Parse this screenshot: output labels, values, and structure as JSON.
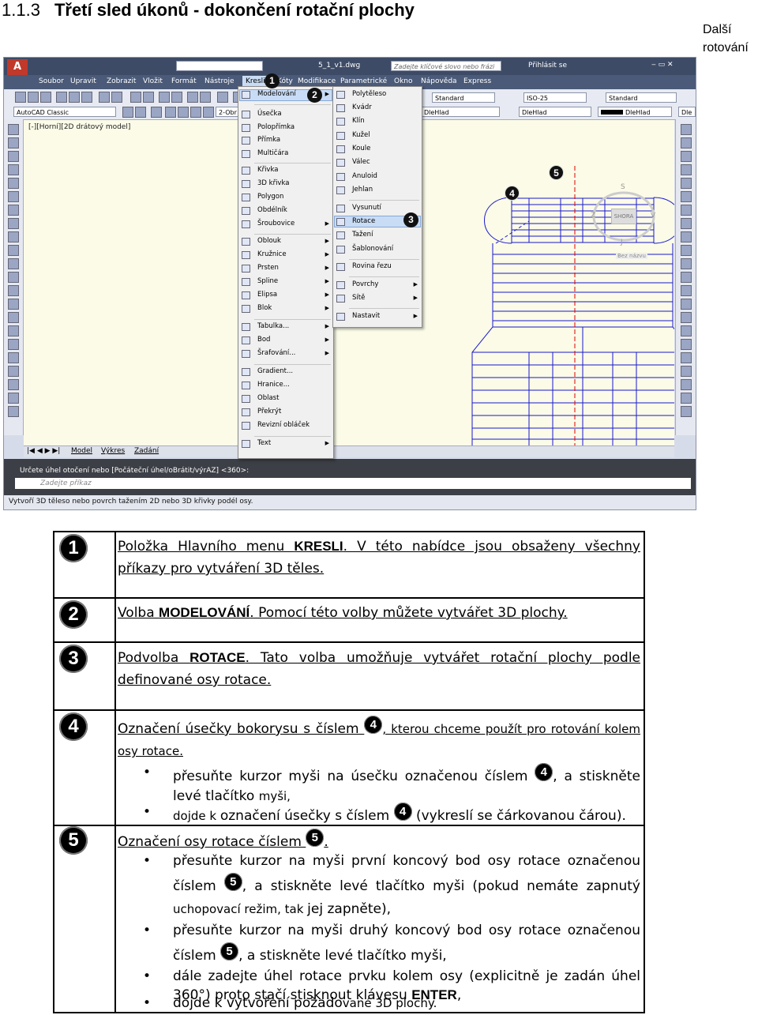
{
  "heading": {
    "number": "1.1.3",
    "title": "Třetí sled úkonů - dokončení rotační plochy"
  },
  "side_note": "Další rotování",
  "screenshot": {
    "workspace": "AutoCAD Classic",
    "filename": "5_1_v1.dwg",
    "search_placeholder": "Zadejte klíčové slovo nebo frázi",
    "signin": "Přihlásit se",
    "menubar": [
      "Soubor",
      "Upravit",
      "Zobrazit",
      "Vložit",
      "Formát",
      "Nástroje",
      "Kresli",
      "Kóty",
      "Modifikace",
      "Parametrické",
      "Okno",
      "Nápověda",
      "Express"
    ],
    "toolbar": {
      "workspace_combo": "AutoCAD Classic",
      "text_style": "Standard",
      "dim_style": "ISO-25",
      "table_style": "Standard",
      "layer": "2-Obr",
      "linetype": "DleHlad",
      "lineweight": "DleHlad",
      "color": "DleHlad",
      "plot": "Dle"
    },
    "viewport_label": "[-][Horní][2D drátový model]",
    "viewcube": {
      "top": "S",
      "right": "V",
      "left": "Z",
      "bottom": "J",
      "face": "SHORA",
      "ucs": "Bez názvu"
    },
    "draw_menu": [
      "Modelování",
      "Úsečka",
      "Polopřímka",
      "Přímka",
      "Multičára",
      "Křivka",
      "3D křivka",
      "Polygon",
      "Obdélník",
      "Šroubovice",
      "Oblouk",
      "Kružnice",
      "Prsten",
      "Spline",
      "Elipsa",
      "Blok",
      "Tabulka...",
      "Bod",
      "Šrafování...",
      "Gradient...",
      "Hranice...",
      "Oblast",
      "Překrýt",
      "Revizní obláček",
      "Text"
    ],
    "modeling_submenu": [
      "Polytěleso",
      "Kvádr",
      "Klín",
      "Kužel",
      "Koule",
      "Válec",
      "Anuloid",
      "Jehlan",
      "Vysunutí",
      "Rotace",
      "Tažení",
      "Šablonování",
      "Rovina řezu",
      "Povrchy",
      "Sítě",
      "Nastavit"
    ],
    "layout_tabs": [
      "Model",
      "Výkres",
      "Zadání"
    ],
    "command_prompt": "Určete úhel otočení nebo [Počáteční úhel/oBrátit/výrAZ] <360>:",
    "command_placeholder": "Zadejte příkaz",
    "status_text": "Vytvoří 3D těleso nebo povrch tažením 2D nebo 3D křivky podél osy.",
    "callouts": [
      "1",
      "2",
      "3",
      "4",
      "5"
    ]
  },
  "legend": {
    "row1": {
      "marker": "1",
      "a": "Položka Hlavního menu ",
      "b": "KRESLI",
      "c": ". V této nabídce jsou obsaženy všechny příkazy pro vytváření 3D těles."
    },
    "row2": {
      "marker": "2",
      "a": "Volba ",
      "b": "MODELOVÁNÍ",
      "c": ". Pomocí této volby můžete vytvářet 3D plochy."
    },
    "row3": {
      "marker": "3",
      "a": "Podvolba ",
      "b": "ROTACE",
      "c": ". Tato volba umožňuje vytvářet rotační plochy podle definované osy rotace."
    },
    "row4": {
      "marker": "4",
      "lead_a": "Označení úsečky bokorysu s číslem ",
      "lead_marker": "4",
      "lead_b": ", kterou chceme použít pro rotování kolem osy rotace.",
      "b1_a": "přesuňte kurzor myši na úsečku označenou číslem ",
      "b1_marker": "4",
      "b1_b": ", a stiskněte levé tlačítko ",
      "b1_c": "myši,",
      "b2_a": "dojde k ",
      "b2_b": "označení úsečky s číslem ",
      "b2_marker": "4",
      "b2_c": " (vykreslí se čárkovanou čárou)."
    },
    "row5": {
      "marker": "5",
      "lead_a": "Označení osy rotace číslem ",
      "lead_marker": "5",
      "lead_b": ".",
      "b1_a": "přesuňte kurzor na myši první koncový bod osy rotace označenou číslem ",
      "b1_marker": "5",
      "b1_b": ", a stiskněte levé tlačítko myši (pokud nemáte zapnutý ",
      "b1_c": "uchopovací režim, tak ",
      "b1_d": "jej zapněte),",
      "b2_a": "přesuňte kurzor na myši druhý koncový bod osy rotace označenou číslem ",
      "b2_marker": "5",
      "b2_b": ", a stiskněte levé tlačítko myši,",
      "b3_a": "dále zadejte úhel rotace prvku kolem osy (explicitně je zadán úhel 360°) proto stačí stisknout klávesu ",
      "b3_b": "ENTER",
      "b3_c": ",",
      "b4_a": "dojde k vytvoření požado",
      "b4_b": "vané 3D plochy."
    }
  },
  "colors": {
    "canvas": "#fbfbe8",
    "drawing": "#1a1acc",
    "menu_highlight": "#c9dcf5",
    "titlebar": "#3d4b66"
  }
}
